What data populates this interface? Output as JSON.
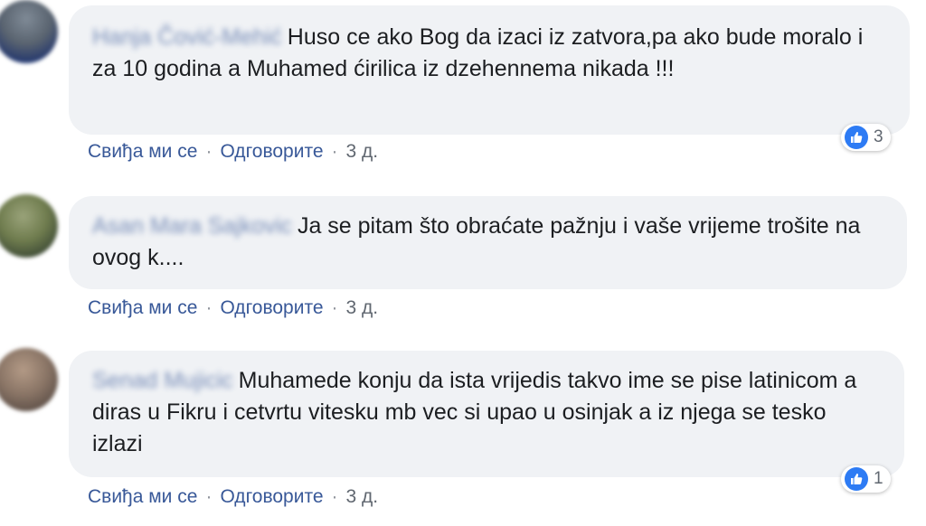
{
  "comments": [
    {
      "author": "Hanja Čović-Mehić",
      "text": "Huso ce ako Bog da izaci iz zatvora,pa ako bude moralo i za 10 godina a Muhamed ćirilica iz dzehennema nikada !!!",
      "reactions": "3",
      "like_label": "Свиђа ми се",
      "reply_label": "Одговорите",
      "time": "3 д."
    },
    {
      "author": "Asan Mara Sajkovic",
      "text": "Ja se pitam što obraćate pažnju i vaše vrijeme trošite na ovog k....",
      "like_label": "Свиђа ми се",
      "reply_label": "Одговорите",
      "time": "3 д."
    },
    {
      "author": "Senad Mujicic",
      "text": "Muhamede konju da ista vrijedis takvo ime se pise latinicom a diras u Fikru i cetvrtu vitesku mb vec si upao u osinjak a iz njega se tesko izlazi",
      "reactions": "1",
      "like_label": "Свиђа ми се",
      "reply_label": "Одговорите",
      "time": "3 д."
    }
  ],
  "colors": {
    "bubble": "#f0f2f5",
    "link": "#385898",
    "like_blue": "#2d7bf4"
  }
}
